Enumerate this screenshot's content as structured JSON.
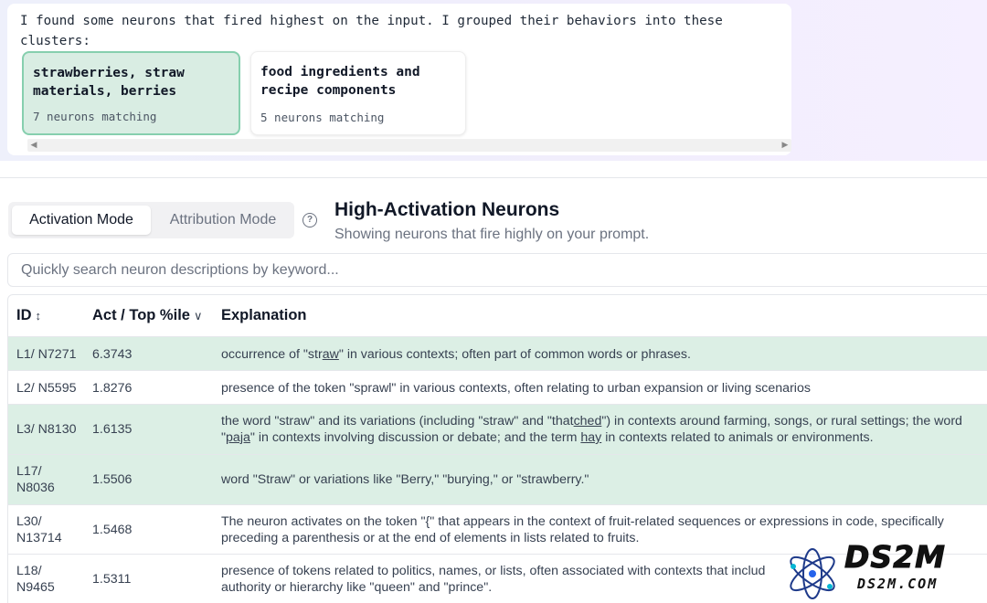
{
  "chat": {
    "message": "I found some neurons that fired highest on the input. I grouped their behaviors into these clusters:",
    "clusters": [
      {
        "title": "strawberries, straw materials, berries",
        "count": "7 neurons matching"
      },
      {
        "title": "food ingredients and recipe components",
        "count": "5 neurons matching"
      }
    ],
    "scroll_left_icon": "triangle-left-icon",
    "scroll_right_icon": "triangle-right-icon"
  },
  "modes": {
    "activation": "Activation Mode",
    "attribution": "Attribution Mode",
    "help_icon": "?"
  },
  "section": {
    "title": "High-Activation Neurons",
    "subtitle": "Showing neurons that fire highly on your prompt."
  },
  "search": {
    "placeholder": "Quickly search neuron descriptions by keyword..."
  },
  "table": {
    "headers": {
      "id": "ID",
      "id_sort": "↕",
      "act": "Act / Top %ile",
      "act_sort": "∨",
      "explanation": "Explanation"
    },
    "rows": [
      {
        "id": "L1/ N7271",
        "act": "6.3743",
        "expl_a": "occurrence of \"str",
        "expl_u": "aw",
        "expl_b": "\" in various contexts; often part of common words or phrases."
      },
      {
        "id": "L2/ N5595",
        "act": "1.8276",
        "explanation": "presence of the token \"sprawl\" in various contexts, often relating to urban expansion or living scenarios"
      },
      {
        "id": "L3/ N8130",
        "act": "1.6135",
        "expl_1": "the word \"straw\" and its variations (including \"straw\" and \"that",
        "expl_1u": "ched",
        "expl_1b": "\") in contexts around farming, songs, or rural settings; the word",
        "expl_2a": "\"",
        "expl_2u": "paja",
        "expl_2b": "\" in contexts involving discussion or debate; and the term ",
        "expl_2u2": "hay",
        "expl_2c": " in contexts related to animals or environments."
      },
      {
        "id_1": "L17/",
        "id_2": "N8036",
        "act": "1.5506",
        "explanation": "word \"Straw\" or variations like \"Berry,\" \"burying,\" or \"strawberry.\""
      },
      {
        "id_1": "L30/",
        "id_2": "N13714",
        "act": "1.5468",
        "expl_1": "The neuron activates on the token \"{\" that appears in the context of fruit-related sequences or expressions in code, specifically",
        "expl_2": "preceding a parenthesis or at the end of elements in lists related to fruits."
      },
      {
        "id_1": "L18/",
        "id_2": "N9465",
        "act": "1.5311",
        "expl_1": "presence of tokens related to politics, names, or lists, often associated with contexts that includ",
        "expl_2": "authority or hierarchy like \"queen\" and \"prince\"."
      }
    ]
  },
  "watermark": {
    "big": "DS2M",
    "small": "DS2M.COM",
    "icon": "atom-logo-icon"
  }
}
